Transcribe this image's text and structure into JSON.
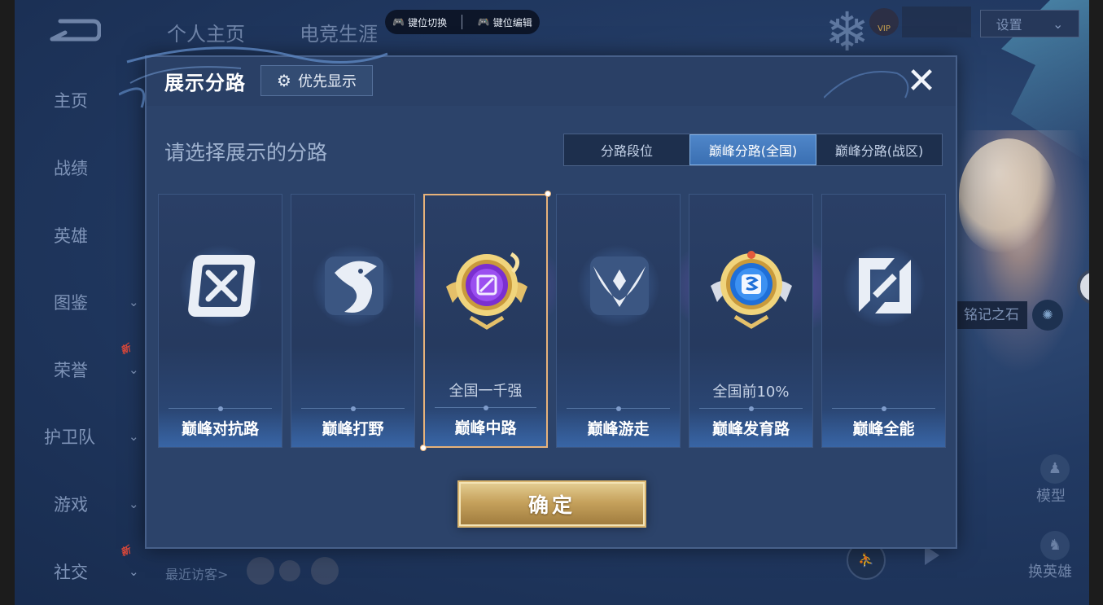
{
  "app": {
    "top_tabs": [
      "个人主页",
      "电竞生涯"
    ],
    "key_pill": {
      "switch_label": "键位切换",
      "edit_label": "键位编辑"
    },
    "settings_label": "设置",
    "vip_label": "VIP"
  },
  "sidebar": {
    "items": [
      {
        "label": "主页",
        "has_chevron": false,
        "new": false
      },
      {
        "label": "战绩",
        "has_chevron": false,
        "new": false
      },
      {
        "label": "英雄",
        "has_chevron": false,
        "new": false
      },
      {
        "label": "图鉴",
        "has_chevron": true,
        "new": false
      },
      {
        "label": "荣誉",
        "has_chevron": true,
        "new": true
      },
      {
        "label": "护卫队",
        "has_chevron": true,
        "new": false
      },
      {
        "label": "游戏",
        "has_chevron": true,
        "new": false
      },
      {
        "label": "社交",
        "has_chevron": true,
        "new": true
      }
    ],
    "new_badge": "新"
  },
  "background": {
    "stone_label": "铭记之石",
    "model_label": "模型",
    "switch_hero_label": "换英雄",
    "recent_visitors_label": "最近访客>"
  },
  "dialog": {
    "title": "展示分路",
    "priority_button": "优先显示",
    "close_symbol": "✕",
    "prompt": "请选择展示的分路",
    "tabs": [
      {
        "label": "分路段位",
        "active": false
      },
      {
        "label": "巅峰分路(全国)",
        "active": true
      },
      {
        "label": "巅峰分路(战区)",
        "active": false
      }
    ],
    "cards": [
      {
        "name": "巅峰对抗路",
        "rank": "",
        "selected": false,
        "emblem": "clash-lane-icon"
      },
      {
        "name": "巅峰打野",
        "rank": "",
        "selected": false,
        "emblem": "jungle-icon"
      },
      {
        "name": "巅峰中路",
        "rank": "全国一千强",
        "selected": true,
        "emblem": "mid-lane-gold-badge-icon"
      },
      {
        "name": "巅峰游走",
        "rank": "",
        "selected": false,
        "emblem": "roam-icon"
      },
      {
        "name": "巅峰发育路",
        "rank": "全国前10%",
        "selected": false,
        "emblem": "farm-lane-gold-badge-icon"
      },
      {
        "name": "巅峰全能",
        "rank": "",
        "selected": false,
        "emblem": "all-round-icon"
      }
    ],
    "confirm_label": "确定"
  },
  "colors": {
    "dialog_bg": "#2a4066",
    "active_tab": "#4a80c2",
    "selected_border": "#e7b27a",
    "confirm_gold": "#c6a25d"
  }
}
